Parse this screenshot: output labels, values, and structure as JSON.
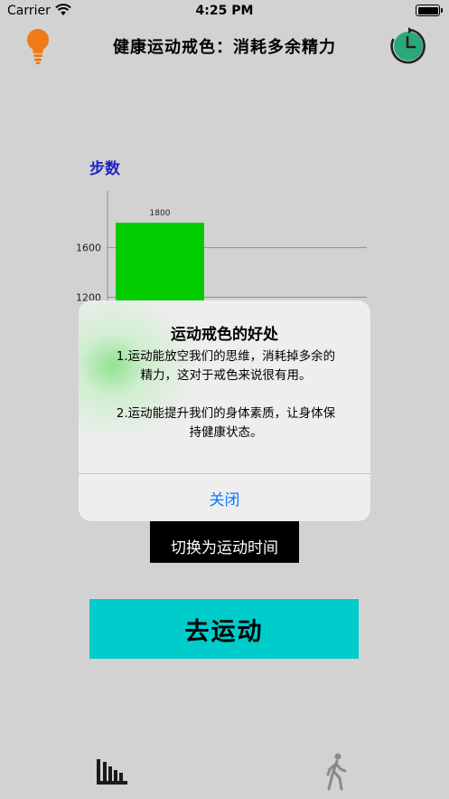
{
  "status_bar": {
    "carrier": "Carrier",
    "time": "4:25 PM"
  },
  "nav": {
    "title": "健康运动戒色：消耗多余精力",
    "left_icon": "bulb-icon",
    "right_icon": "history-icon"
  },
  "colors": {
    "bar": "#00cc00",
    "accent": "#00cccc",
    "link": "#0a7aff",
    "chart_title": "#2020c8",
    "bulb": "#f07a1a",
    "history": "#2aa87a"
  },
  "chart_data": {
    "type": "bar",
    "title": "步数",
    "categories": [
      ""
    ],
    "values": [
      1800
    ],
    "value_labels": [
      "1800"
    ],
    "yticks": [
      1200,
      1600
    ],
    "ytick_labels": [
      "1200",
      "1600"
    ],
    "ylim_visible": [
      1080,
      2100
    ],
    "grid": true
  },
  "switch_button": {
    "label": "切换为运动时间"
  },
  "go_button": {
    "label": "去运动"
  },
  "tabbar": {
    "stats_icon": "bar-chart-icon",
    "exercise_icon": "walking-person-icon"
  },
  "alert": {
    "title": "运动戒色的好处",
    "message_lines": [
      "1.运动能放空我们的思维，消耗掉多余的",
      "精力，这对于戒色来说很有用。",
      "2.运动能提升我们的身体素质，让身体保",
      "持健康状态。"
    ],
    "close_label": "关闭"
  }
}
